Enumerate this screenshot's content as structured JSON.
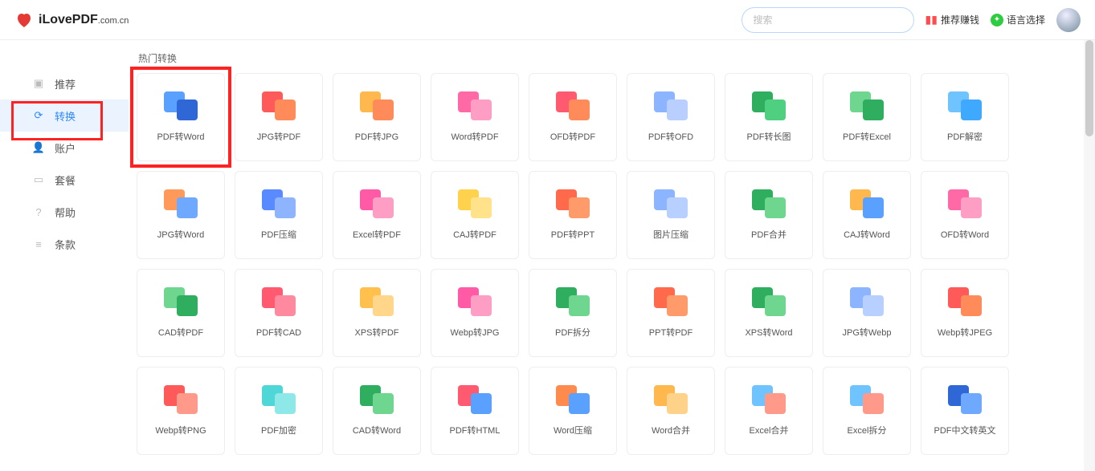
{
  "brand": {
    "name": "iLovePDF",
    "suffix": ".com.cn"
  },
  "search": {
    "placeholder": "搜索"
  },
  "header_links": {
    "refer": "推荐赚钱",
    "language": "语言选择"
  },
  "sidebar": {
    "items": [
      {
        "label": "推荐",
        "icon": "gift-icon"
      },
      {
        "label": "转换",
        "icon": "convert-icon"
      },
      {
        "label": "账户",
        "icon": "user-icon"
      },
      {
        "label": "套餐",
        "icon": "card-icon"
      },
      {
        "label": "帮助",
        "icon": "help-icon"
      },
      {
        "label": "条款",
        "icon": "terms-icon"
      }
    ],
    "active_index": 1
  },
  "section": {
    "title": "热门转换"
  },
  "tools": [
    {
      "label": "PDF转Word",
      "c1": "#5aa0ff",
      "c2": "#2f68d6"
    },
    {
      "label": "JPG转PDF",
      "c1": "#ff5a5a",
      "c2": "#ff8a5a"
    },
    {
      "label": "PDF转JPG",
      "c1": "#ffb84d",
      "c2": "#ff8a5a"
    },
    {
      "label": "Word转PDF",
      "c1": "#ff6aa6",
      "c2": "#ff9ec4"
    },
    {
      "label": "OFD转PDF",
      "c1": "#ff5a70",
      "c2": "#ff8a5a"
    },
    {
      "label": "PDF转OFD",
      "c1": "#8db4ff",
      "c2": "#b8cfff"
    },
    {
      "label": "PDF转长图",
      "c1": "#2fae60",
      "c2": "#4fcf80"
    },
    {
      "label": "PDF转Excel",
      "c1": "#6fd68f",
      "c2": "#2fae60"
    },
    {
      "label": "PDF解密",
      "c1": "#6fc3ff",
      "c2": "#3fa8ff"
    },
    {
      "label": "JPG转Word",
      "c1": "#ff9a5a",
      "c2": "#6fa8ff"
    },
    {
      "label": "PDF压缩",
      "c1": "#5a8aff",
      "c2": "#8fb4ff"
    },
    {
      "label": "Excel转PDF",
      "c1": "#ff5aa6",
      "c2": "#ff9ec4"
    },
    {
      "label": "CAJ转PDF",
      "c1": "#ffd24d",
      "c2": "#ffe28a"
    },
    {
      "label": "PDF转PPT",
      "c1": "#ff6a4d",
      "c2": "#ff9a6a"
    },
    {
      "label": "图片压缩",
      "c1": "#8db4ff",
      "c2": "#b8d0ff"
    },
    {
      "label": "PDF合并",
      "c1": "#2fae60",
      "c2": "#6fd68f"
    },
    {
      "label": "CAJ转Word",
      "c1": "#ffb84d",
      "c2": "#5aa0ff"
    },
    {
      "label": "OFD转Word",
      "c1": "#ff6aa6",
      "c2": "#ff9ec4"
    },
    {
      "label": "CAD转PDF",
      "c1": "#6fd68f",
      "c2": "#2fae60"
    },
    {
      "label": "PDF转CAD",
      "c1": "#ff5a70",
      "c2": "#ff8aa0"
    },
    {
      "label": "XPS转PDF",
      "c1": "#ffc04d",
      "c2": "#ffd68a"
    },
    {
      "label": "Webp转JPG",
      "c1": "#ff5aa6",
      "c2": "#ff9ec4"
    },
    {
      "label": "PDF拆分",
      "c1": "#2fae60",
      "c2": "#6fd68f"
    },
    {
      "label": "PPT转PDF",
      "c1": "#ff6a4d",
      "c2": "#ff9a6a"
    },
    {
      "label": "XPS转Word",
      "c1": "#2fae60",
      "c2": "#6fd68f"
    },
    {
      "label": "JPG转Webp",
      "c1": "#8db4ff",
      "c2": "#b8d0ff"
    },
    {
      "label": "Webp转JPEG",
      "c1": "#ff5a5a",
      "c2": "#ff8a5a"
    },
    {
      "label": "Webp转PNG",
      "c1": "#ff5a5a",
      "c2": "#ff9a8a"
    },
    {
      "label": "PDF加密",
      "c1": "#4fd6d6",
      "c2": "#8fe8e8"
    },
    {
      "label": "CAD转Word",
      "c1": "#2fae60",
      "c2": "#6fd68f"
    },
    {
      "label": "PDF转HTML",
      "c1": "#ff5a70",
      "c2": "#5aa0ff"
    },
    {
      "label": "Word压缩",
      "c1": "#ff8a4d",
      "c2": "#5aa0ff"
    },
    {
      "label": "Word合并",
      "c1": "#ffb84d",
      "c2": "#ffd28a"
    },
    {
      "label": "Excel合并",
      "c1": "#6fc3ff",
      "c2": "#ff9a8a"
    },
    {
      "label": "Excel拆分",
      "c1": "#6fc3ff",
      "c2": "#ff9a8a"
    },
    {
      "label": "PDF中文转英文",
      "c1": "#2f68d6",
      "c2": "#6fa8ff"
    }
  ],
  "highlight": {
    "card_index": 0
  }
}
